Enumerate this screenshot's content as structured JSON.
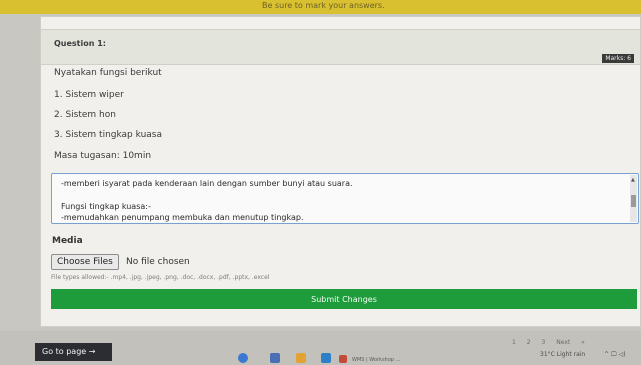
{
  "top_bar": {
    "message": "Be sure to mark your answers."
  },
  "question": {
    "title": "Question 1:",
    "marks": "Marks: 6",
    "prompt": "Nyatakan fungsi berikut",
    "items": [
      "1. Sistem wiper",
      "2. Sistem hon",
      "3. Sistem tingkap kuasa"
    ],
    "time": "Masa tugasan: 10min"
  },
  "answer": {
    "lines": [
      "-memberi isyarat pada kenderaan lain dengan sumber bunyi atau suara.",
      "",
      "Fungsi tingkap kuasa:-",
      "-memudahkan penumpang membuka dan menutup tingkap."
    ]
  },
  "media": {
    "label": "Media",
    "choose_label": "Choose Files",
    "no_file": "No file chosen",
    "file_types": "File types allowed:- .mp4, .jpg, .jpeg, .png, .doc, .docx, .pdf, .pptx, .excel"
  },
  "submit_label": "Submit Changes",
  "footer": {
    "goto_label": "Go to page →",
    "pages": [
      "1",
      "2",
      "3",
      "Next",
      "»"
    ]
  },
  "taskbar": {
    "window_label": "WMS | Workshop ...",
    "weather": "31°C  Light rain",
    "tray": "^  🖵 ◁)"
  }
}
